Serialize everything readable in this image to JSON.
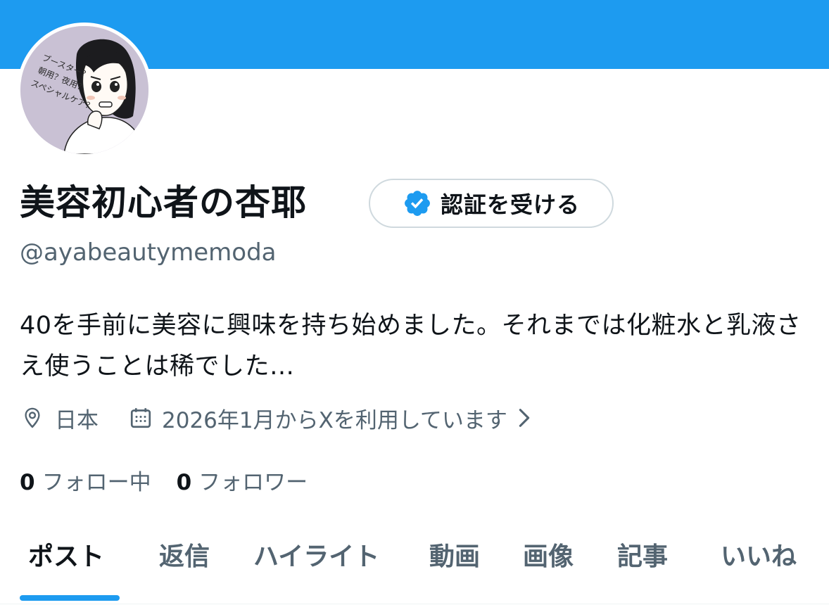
{
  "colors": {
    "banner": "#1d9bf0",
    "accent": "#1d9bf0",
    "text_primary": "#0f1419",
    "text_secondary": "#536471",
    "border": "#cfd9de"
  },
  "profile": {
    "display_name": "美容初心者の杏耶",
    "handle": "@ayabeautymemoda",
    "bio": "40を手前に美容に興味を持ち始めました。それまでは化粧水と乳液さえ使うことは稀でした…",
    "location": "日本",
    "joined": "2026年1月からXを利用しています",
    "avatar_text": [
      "ブースター？",
      "朝用？夜用？",
      "スペシャルケア？"
    ]
  },
  "verify_button": {
    "label": "認証を受ける",
    "icon": "verified-badge-icon"
  },
  "stats": {
    "following_count": "0",
    "following_label": "フォロー中",
    "followers_count": "0",
    "followers_label": "フォロワー"
  },
  "tabs": [
    {
      "label": "ポスト",
      "active": true
    },
    {
      "label": "返信",
      "active": false
    },
    {
      "label": "ハイライト",
      "active": false
    },
    {
      "label": "動画",
      "active": false
    },
    {
      "label": "画像",
      "active": false
    },
    {
      "label": "記事",
      "active": false
    },
    {
      "label": "いいね",
      "active": false
    }
  ],
  "icons": {
    "location": "location-pin-icon",
    "joined": "calendar-icon",
    "more": "chevron-right-icon"
  }
}
